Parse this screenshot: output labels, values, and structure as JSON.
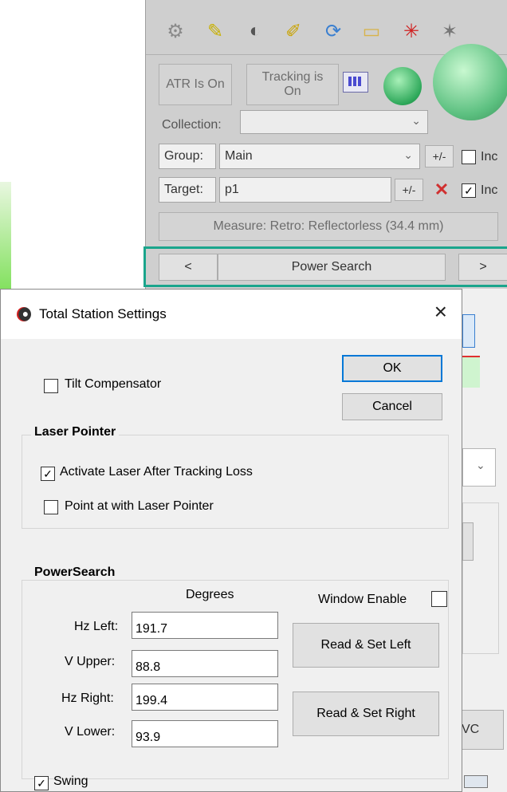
{
  "background_app": {
    "toolbar_icons": [
      "gear-icon",
      "pencil-icon",
      "target-scope-icon",
      "brush-target-icon",
      "refresh-icon",
      "folder-icon",
      "laser-burst-icon",
      "magic-wand-icon"
    ],
    "atr_label": "ATR Is On",
    "tracking_label": "Tracking is On",
    "collection_label": "Collection:",
    "collection_value": "",
    "group_label": "Group:",
    "group_value": "Main",
    "group_plusminus": "+/-",
    "group_check_label": "Inc",
    "target_label": "Target:",
    "target_value": "p1",
    "target_plusminus": "+/-",
    "target_check_label": "Inc",
    "measure_label": "Measure: Retro: Reflectorless (34.4 mm)",
    "nav_prev": "<",
    "power_search": "Power Search",
    "nav_next": ">",
    "partial_vc": "VC",
    "highlight_color": "#1aa58c"
  },
  "dialog": {
    "title": "Total Station Settings",
    "close": "×",
    "ok": "OK",
    "cancel": "Cancel",
    "tilt_compensator": "Tilt Compensator",
    "tilt_checked": false,
    "laser_group": "Laser Pointer",
    "activate_laser": "Activate Laser After Tracking Loss",
    "activate_checked": true,
    "point_at": "Point at with Laser Pointer",
    "point_checked": false,
    "powersearch_group": "PowerSearch",
    "degrees_header": "Degrees",
    "window_enable": "Window Enable",
    "window_enable_checked": false,
    "hz_left_label": "Hz Left:",
    "hz_left": "191.7",
    "v_upper_label": "V Upper:",
    "v_upper": "88.8",
    "hz_right_label": "Hz Right:",
    "hz_right": "199.4",
    "v_lower_label": "V Lower:",
    "v_lower": "93.9",
    "read_set_left": "Read & Set Left",
    "read_set_right": "Read & Set Right",
    "swing": "Swing",
    "swing_checked": true
  }
}
